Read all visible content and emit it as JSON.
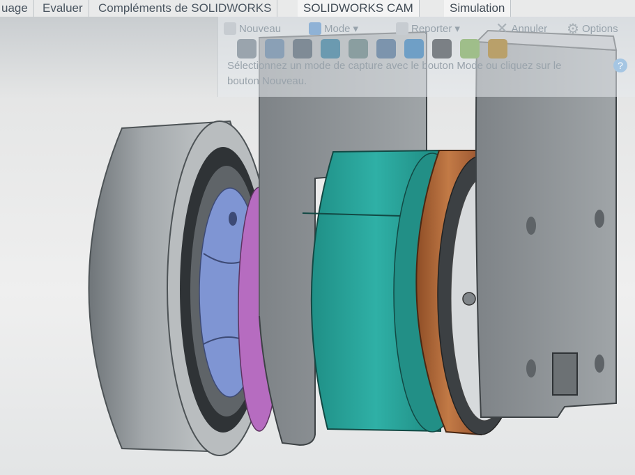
{
  "ribbon_tabs": [
    "uage",
    "Evaluer",
    "Compléments de SOLIDWORKS",
    "SOLIDWORKS CAM",
    "Simulation"
  ],
  "capture_toolbar": {
    "new_label": "Nouveau",
    "mode_label": "Mode",
    "report_label": "Reporter",
    "cancel_label": "Annuler",
    "options_label": "Options",
    "hint": "Sélectionnez un mode de capture avec le bouton Mode ou cliquez sur le bouton Nouveau.",
    "help_glyph": "?"
  },
  "colors": {
    "teal_part": "#2aa49b",
    "copper_part": "#b46a3c",
    "blue_hub": "#7f95d3",
    "magenta_ring": "#b66cc0",
    "tire_grey": "#9aa0a4",
    "bracket_grey": "#8d9296"
  }
}
